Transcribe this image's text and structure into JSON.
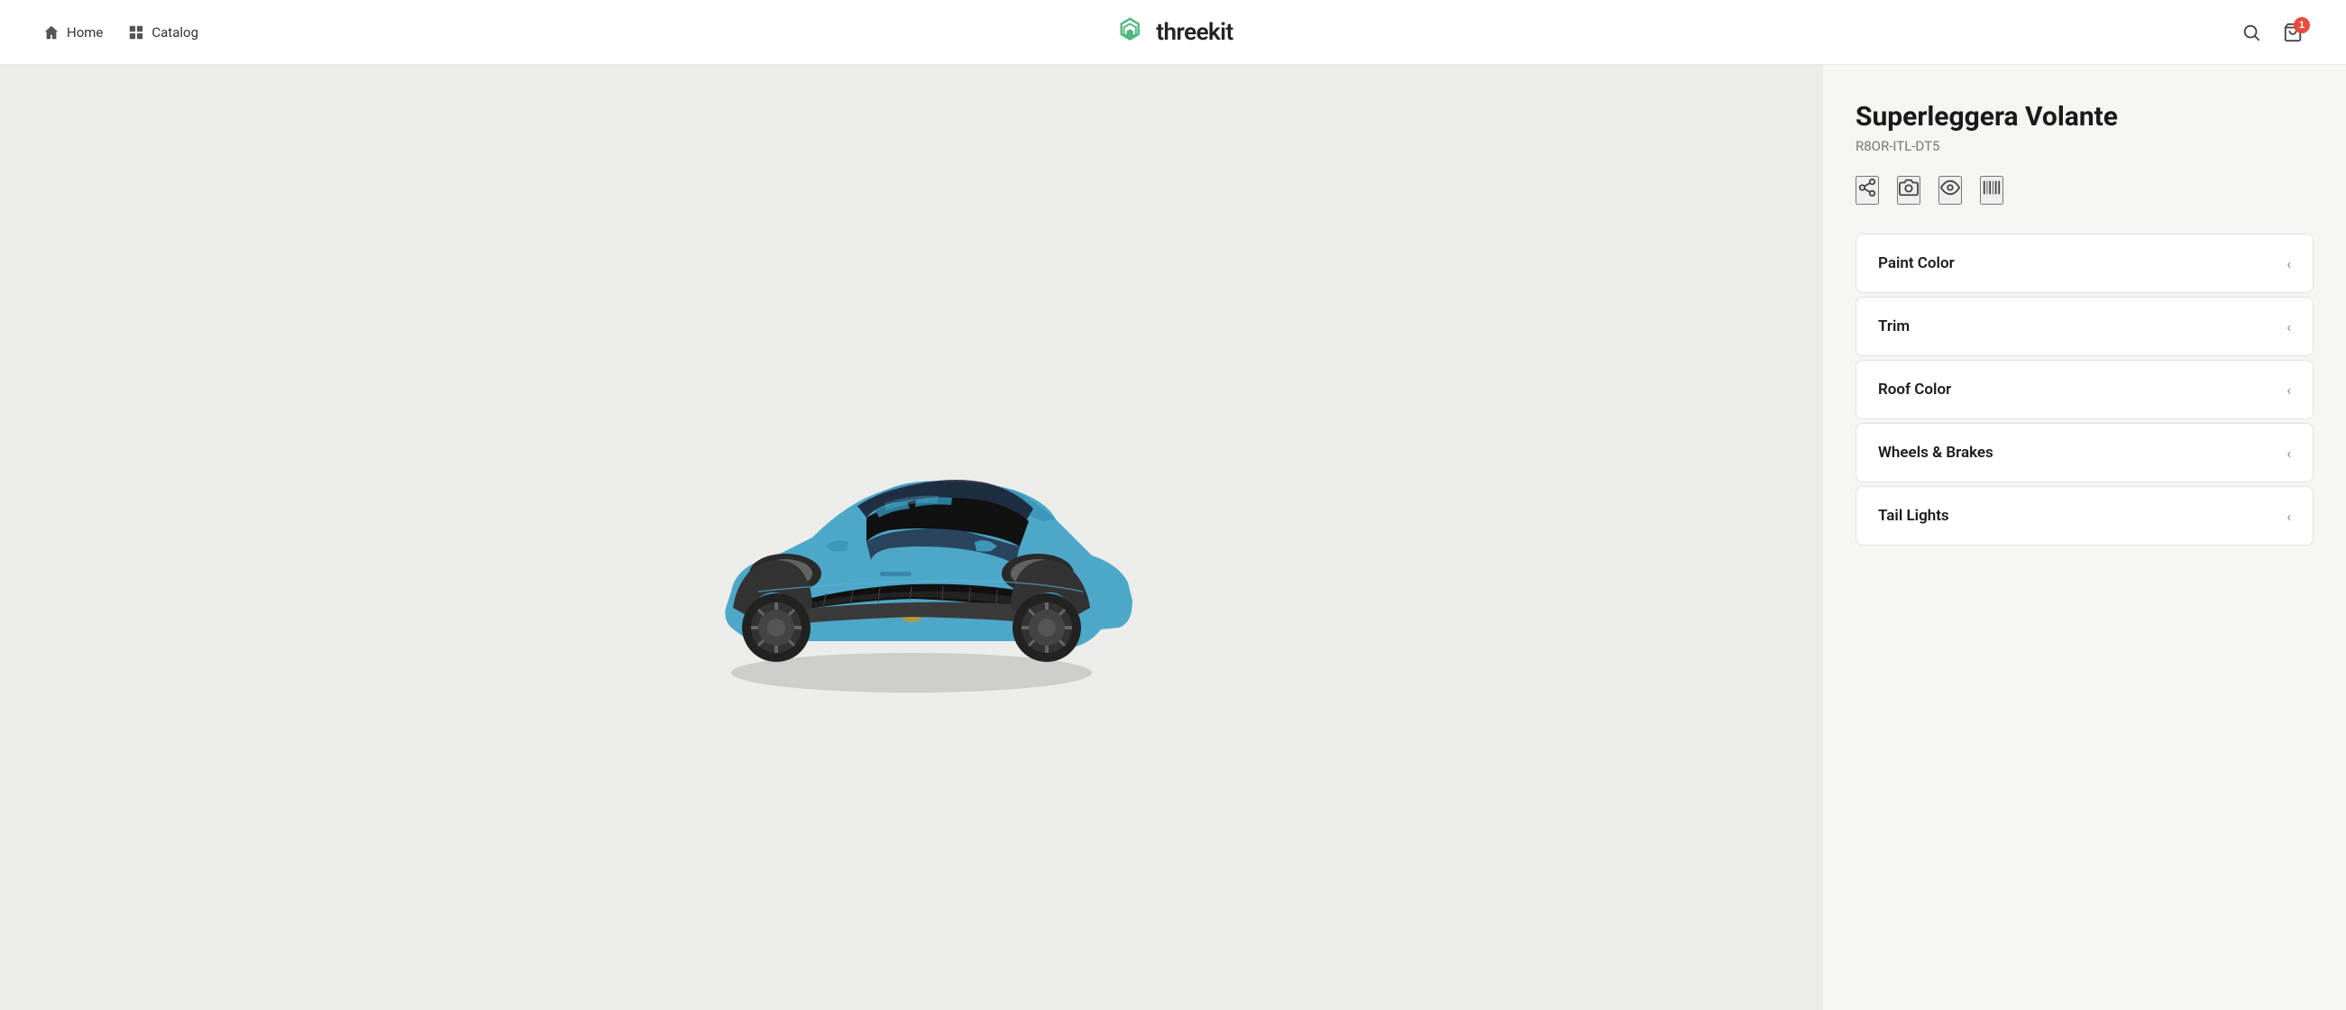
{
  "brand": {
    "name": "threekit",
    "logo_alt": "threekit logo"
  },
  "nav": {
    "left_items": [
      {
        "id": "home",
        "label": "Home",
        "icon": "home-icon"
      },
      {
        "id": "catalog",
        "label": "Catalog",
        "icon": "catalog-icon"
      }
    ],
    "right_icons": [
      {
        "id": "search",
        "icon": "search-icon"
      },
      {
        "id": "cart",
        "icon": "cart-icon",
        "badge": "1"
      }
    ]
  },
  "product": {
    "title": "Superleggera Volante",
    "sku": "R8OR-ITL-DT5",
    "action_icons": [
      {
        "id": "share",
        "icon": "share-icon"
      },
      {
        "id": "camera",
        "icon": "camera-icon"
      },
      {
        "id": "view",
        "icon": "eye-icon"
      },
      {
        "id": "barcode",
        "icon": "barcode-icon"
      }
    ]
  },
  "configurator": {
    "sections": [
      {
        "id": "paint-color",
        "label": "Paint Color"
      },
      {
        "id": "trim",
        "label": "Trim"
      },
      {
        "id": "roof-color",
        "label": "Roof Color"
      },
      {
        "id": "wheels-brakes",
        "label": "Wheels & Brakes"
      },
      {
        "id": "tail-lights",
        "label": "Tail Lights"
      }
    ]
  },
  "colors": {
    "brand_green": "#4db87c",
    "accent_red": "#e74c3c"
  }
}
